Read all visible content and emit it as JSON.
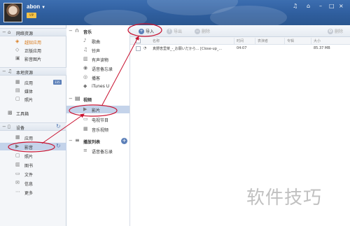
{
  "user": {
    "name": "abon",
    "badge": "VIP"
  },
  "colors": {
    "header": "#2f5e9e",
    "selection": "#c4d3ea",
    "annotation": "#c8102e",
    "accent": "#5b7fb8"
  },
  "header_icons": [
    "music-note-icon",
    "shirt-icon",
    "minimize-icon",
    "restore-icon",
    "close-icon"
  ],
  "sidebar": {
    "network": {
      "title": "网络资源",
      "items": [
        "越狱应用",
        "正版应用",
        "影音图片"
      ]
    },
    "local": {
      "title": "本地资源",
      "items": [
        {
          "label": "应用",
          "badge": "335"
        },
        {
          "label": "媒体"
        },
        {
          "label": "照片"
        }
      ]
    },
    "toolbox": "工具箱",
    "device": {
      "title": "设备",
      "items": [
        "应用",
        "影音",
        "照片",
        "图书",
        "文件",
        "信息",
        "更多"
      ]
    }
  },
  "media": {
    "music": {
      "title": "音乐",
      "items": [
        "歌曲",
        "铃声",
        "有声读物",
        "语音备忘录",
        "播客",
        "iTunes U"
      ]
    },
    "video": {
      "title": "视频",
      "items": [
        "影片",
        "电视节目",
        "音乐视频"
      ]
    },
    "playlist": {
      "title": "播放列表",
      "items": [
        "语音备忘录"
      ]
    }
  },
  "toolbar": {
    "import": "导入",
    "export": "导出",
    "delete": "删除",
    "settings": "删除"
  },
  "table": {
    "columns": [
      "名称",
      "时间",
      "表演者",
      "专辑",
      "大小"
    ],
    "rows": [
      {
        "name": "真野恵里菜_-_お願いだから... [Close-up_...",
        "time": "04:07",
        "artist": "",
        "album": "",
        "size": "85.37 MB"
      }
    ]
  },
  "watermark": "软件技巧"
}
